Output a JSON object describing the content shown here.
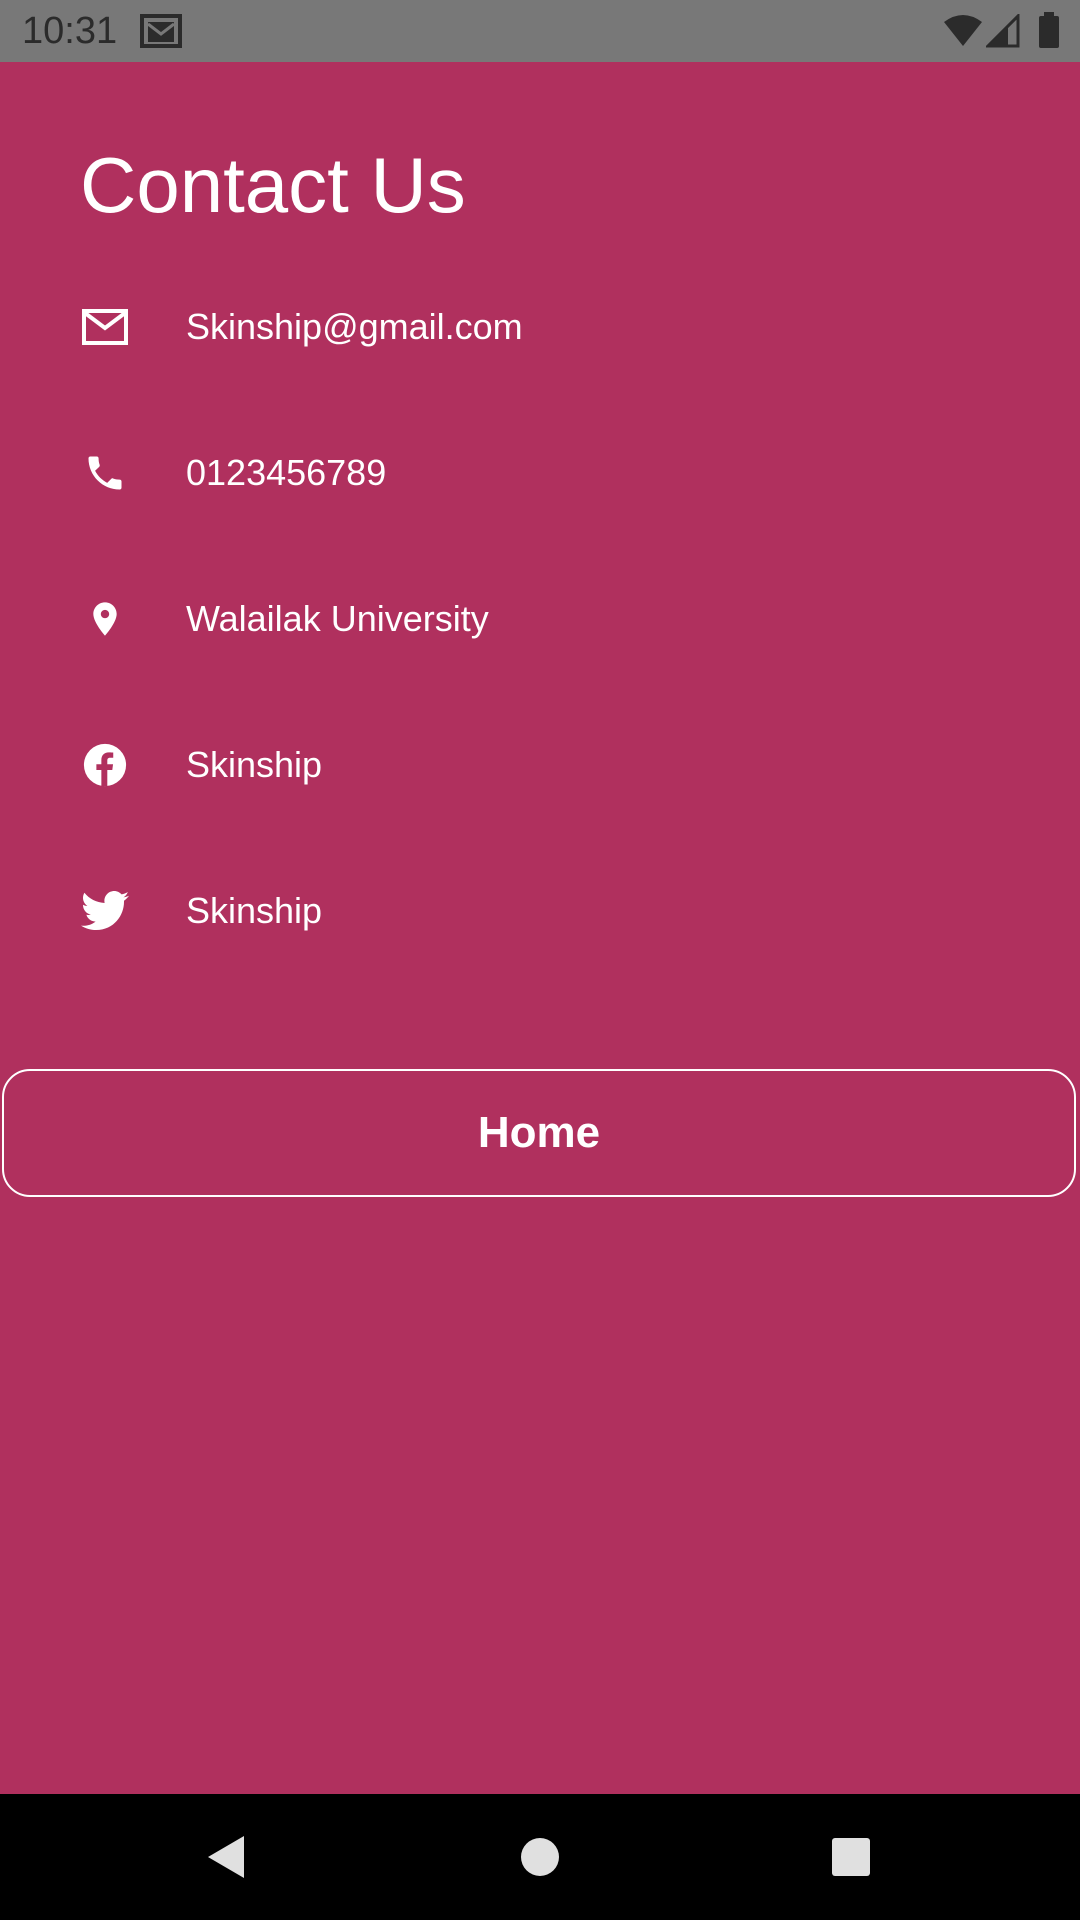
{
  "status_bar": {
    "time": "10:31",
    "icons": [
      "gmail-icon",
      "wifi-icon",
      "signal-icon",
      "battery-icon"
    ]
  },
  "page": {
    "title": "Contact Us",
    "background_color": "#b0305e",
    "text_color": "#ffffff"
  },
  "contacts": [
    {
      "icon": "mail-icon",
      "text": "Skinship@gmail.com"
    },
    {
      "icon": "phone-icon",
      "text": "0123456789"
    },
    {
      "icon": "location-pin-icon",
      "text": "Walailak University"
    },
    {
      "icon": "facebook-icon",
      "text": "Skinship"
    },
    {
      "icon": "twitter-icon",
      "text": "Skinship"
    }
  ],
  "home_button": {
    "label": "Home"
  },
  "nav_bar": {
    "buttons": [
      "back-icon",
      "home-circle-icon",
      "recents-square-icon"
    ]
  }
}
